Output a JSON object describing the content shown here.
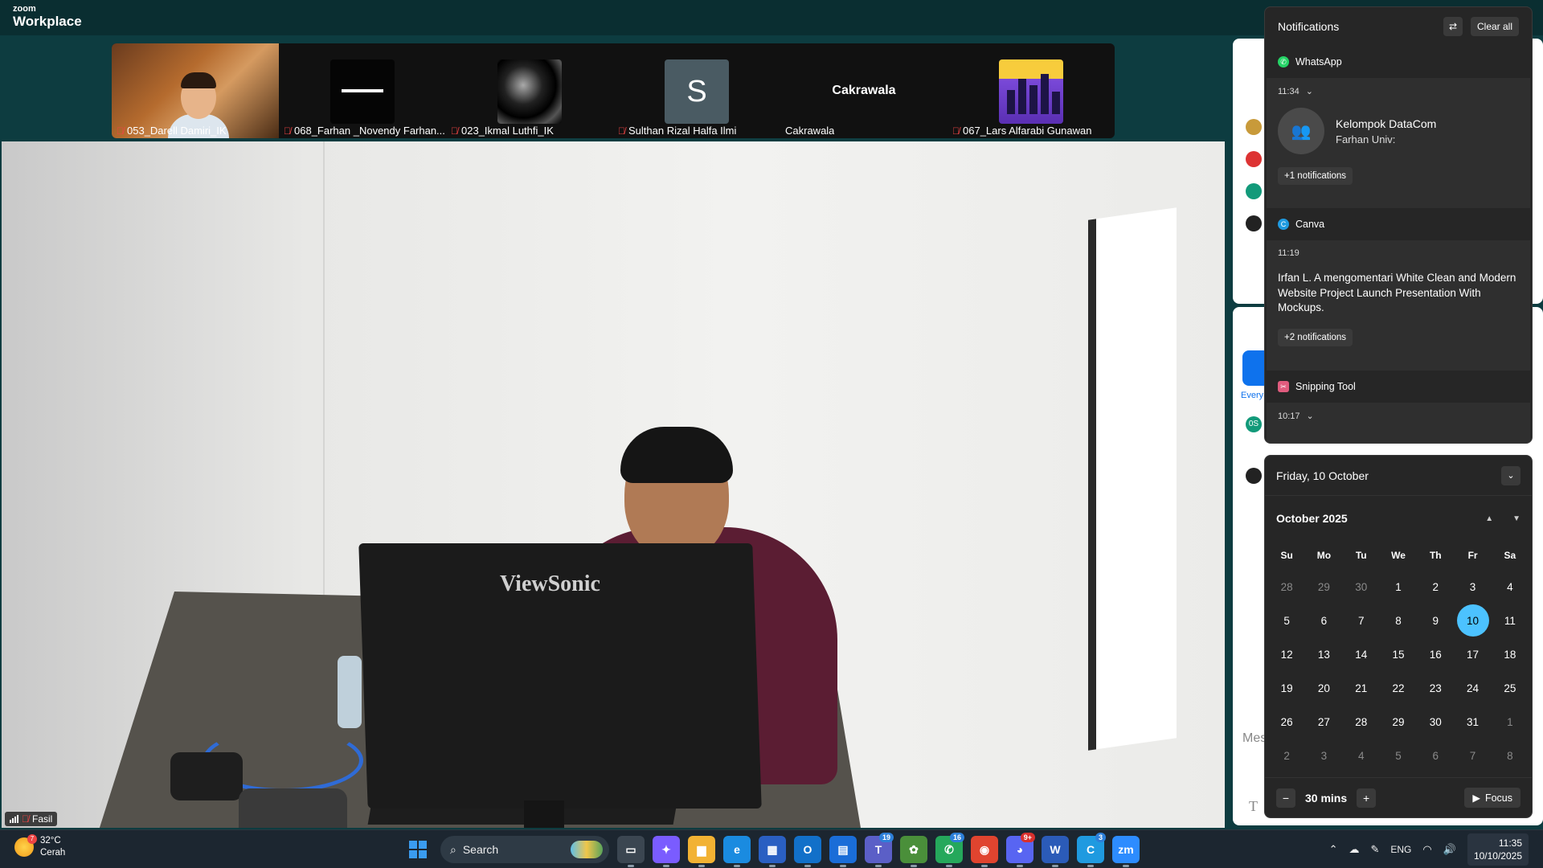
{
  "zoom": {
    "logo_small": "zoom",
    "logo_big": "Workplace"
  },
  "participants": [
    {
      "name": "053_Darell Damiri_IK",
      "muted": true
    },
    {
      "name": "068_Farhan _Novendy Farhan...",
      "muted": true
    },
    {
      "name": "023_Ikmal Luthfi_IK",
      "muted": true
    },
    {
      "name": "Sulthan Rizal Halfa Ilmi",
      "muted": true,
      "initial": "S"
    },
    {
      "name": "Cakrawala",
      "muted": false,
      "tile_label": "Cakrawala"
    },
    {
      "name": "067_Lars Alfarabi Gunawan",
      "muted": true
    }
  ],
  "main_video": {
    "speaker_name": "Fasil",
    "monitor_brand": "ViewSonic"
  },
  "zoom_side": {
    "everyone_label": "Every",
    "message_placeholder": "Mes",
    "text_tool": "T",
    "avatar_badge": "0S"
  },
  "notifications": {
    "title": "Notifications",
    "clear_all": "Clear all",
    "groups": [
      {
        "app": "WhatsApp",
        "time": "11:34",
        "title": "Kelompok DataCom",
        "body": "Farhan Univ:",
        "more": "+1 notifications"
      },
      {
        "app": "Canva",
        "time": "11:19",
        "body": "Irfan L. A mengomentari White Clean and Modern Website Project Launch Presentation With Mockups.",
        "more": "+2 notifications"
      },
      {
        "app": "Snipping Tool",
        "time": "10:17"
      }
    ]
  },
  "calendar": {
    "header_date": "Friday, 10 October",
    "month_label": "October 2025",
    "weekdays": [
      "Su",
      "Mo",
      "Tu",
      "We",
      "Th",
      "Fr",
      "Sa"
    ],
    "days": [
      {
        "d": "28",
        "dim": true
      },
      {
        "d": "29",
        "dim": true
      },
      {
        "d": "30",
        "dim": true
      },
      {
        "d": "1"
      },
      {
        "d": "2"
      },
      {
        "d": "3"
      },
      {
        "d": "4"
      },
      {
        "d": "5"
      },
      {
        "d": "6"
      },
      {
        "d": "7"
      },
      {
        "d": "8"
      },
      {
        "d": "9"
      },
      {
        "d": "10",
        "today": true
      },
      {
        "d": "11"
      },
      {
        "d": "12"
      },
      {
        "d": "13"
      },
      {
        "d": "14"
      },
      {
        "d": "15"
      },
      {
        "d": "16"
      },
      {
        "d": "17"
      },
      {
        "d": "18"
      },
      {
        "d": "19"
      },
      {
        "d": "20"
      },
      {
        "d": "21"
      },
      {
        "d": "22"
      },
      {
        "d": "23"
      },
      {
        "d": "24"
      },
      {
        "d": "25"
      },
      {
        "d": "26"
      },
      {
        "d": "27"
      },
      {
        "d": "28"
      },
      {
        "d": "29"
      },
      {
        "d": "30"
      },
      {
        "d": "31"
      },
      {
        "d": "1",
        "dim": true
      },
      {
        "d": "2",
        "dim": true
      },
      {
        "d": "3",
        "dim": true
      },
      {
        "d": "4",
        "dim": true
      },
      {
        "d": "5",
        "dim": true
      },
      {
        "d": "6",
        "dim": true
      },
      {
        "d": "7",
        "dim": true
      },
      {
        "d": "8",
        "dim": true
      }
    ],
    "focus_duration": "30 mins",
    "focus_label": "Focus"
  },
  "taskbar": {
    "weather_temp": "32°C",
    "weather_desc": "Cerah",
    "weather_badge": "7",
    "search_label": "Search",
    "apps": [
      {
        "name": "task-view",
        "glyph": "▭"
      },
      {
        "name": "copilot",
        "glyph": "✦"
      },
      {
        "name": "file-explorer",
        "glyph": "▆"
      },
      {
        "name": "edge",
        "glyph": "e"
      },
      {
        "name": "store",
        "glyph": "▦"
      },
      {
        "name": "outlook",
        "glyph": "O"
      },
      {
        "name": "trello",
        "glyph": "▤"
      },
      {
        "name": "teams",
        "glyph": "T",
        "badge": "19"
      },
      {
        "name": "app-extra",
        "glyph": "✿"
      },
      {
        "name": "whatsapp",
        "glyph": "✆",
        "badge": "16"
      },
      {
        "name": "chrome",
        "glyph": "◉"
      },
      {
        "name": "discord",
        "glyph": "◕",
        "badge": "9+"
      },
      {
        "name": "word",
        "glyph": "W"
      },
      {
        "name": "canva",
        "glyph": "C",
        "badge": "3"
      },
      {
        "name": "zoom",
        "glyph": "zm"
      }
    ],
    "lang": "ENG",
    "time": "11:35",
    "date": "10/10/2025"
  },
  "colors": {
    "zoom_bg": "#0d3c40",
    "accent_blue": "#4cc2ff",
    "panel_bg": "#262626",
    "taskbar_bg": "#1c2630"
  }
}
